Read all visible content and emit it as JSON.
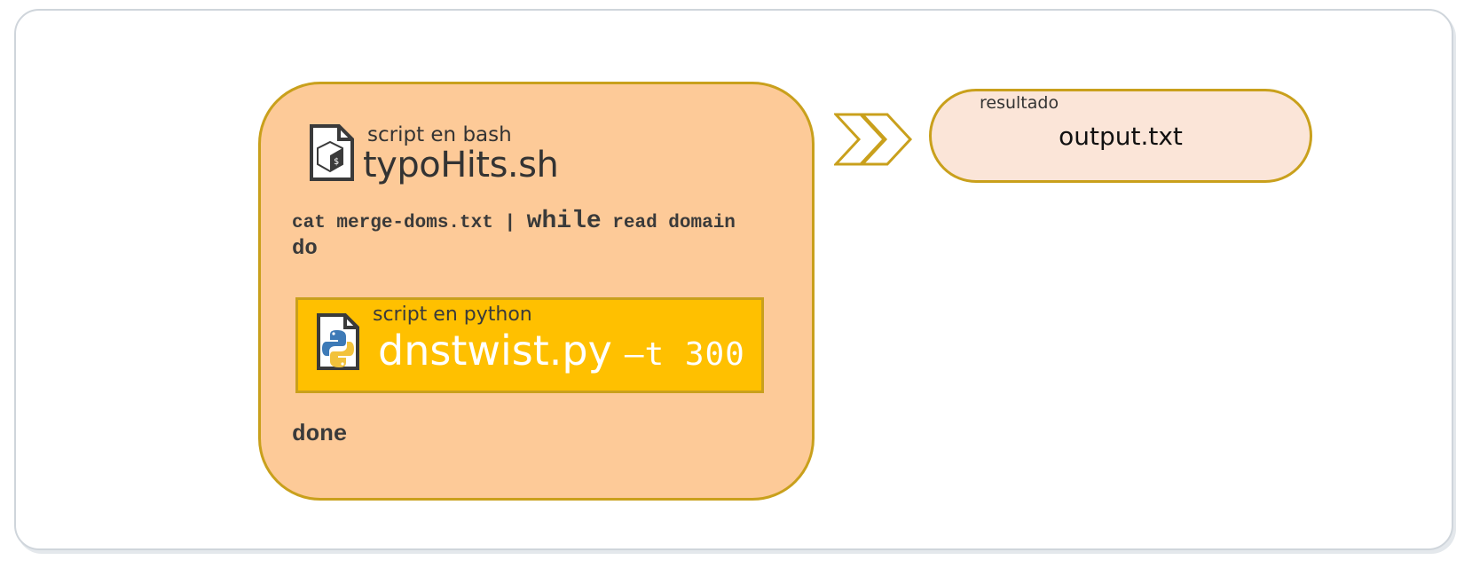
{
  "bash_script": {
    "caption": "script en bash",
    "filename": "typoHits.sh",
    "code_line1_before": "cat merge-doms.txt | ",
    "code_line1_keyword": "while",
    "code_line1_after": " read domain",
    "code_line2": "do",
    "code_line3": "done",
    "icon": "bash-file-icon"
  },
  "python_script": {
    "caption": "script en python",
    "filename": "dnstwist.py",
    "args": "–t 300",
    "icon": "python-file-icon"
  },
  "arrow": {
    "icon": "double-chevron-right-icon"
  },
  "result": {
    "caption": "resultado",
    "filename": "output.txt"
  },
  "colors": {
    "bash_fill": "#fdca98",
    "python_fill": "#ffc000",
    "result_fill": "#fbe5d8",
    "border_gold": "#c9a01c",
    "frame_border": "#cfd5db"
  }
}
